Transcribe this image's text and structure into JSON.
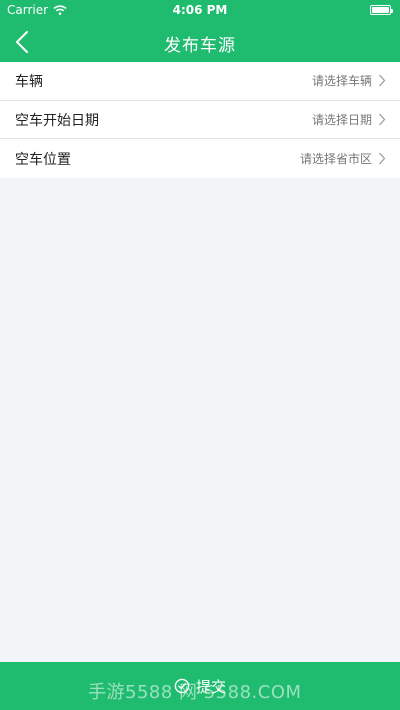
{
  "status_bar": {
    "carrier": "Carrier",
    "time": "4:06 PM",
    "icons": [
      "wifi-icon",
      "battery-icon"
    ]
  },
  "nav": {
    "title": "发布车源",
    "back_icon": "chevron-left-icon"
  },
  "form": {
    "rows": [
      {
        "label": "车辆",
        "value": "请选择车辆"
      },
      {
        "label": "空车开始日期",
        "value": "请选择日期"
      },
      {
        "label": "空车位置",
        "value": "请选择省市区"
      }
    ]
  },
  "submit": {
    "label": "提交",
    "icon": "check-circle-icon"
  },
  "watermark": "手游5588 网 5588.COM",
  "colors": {
    "accent": "#1fbb6f",
    "background": "#f1f5f8"
  }
}
